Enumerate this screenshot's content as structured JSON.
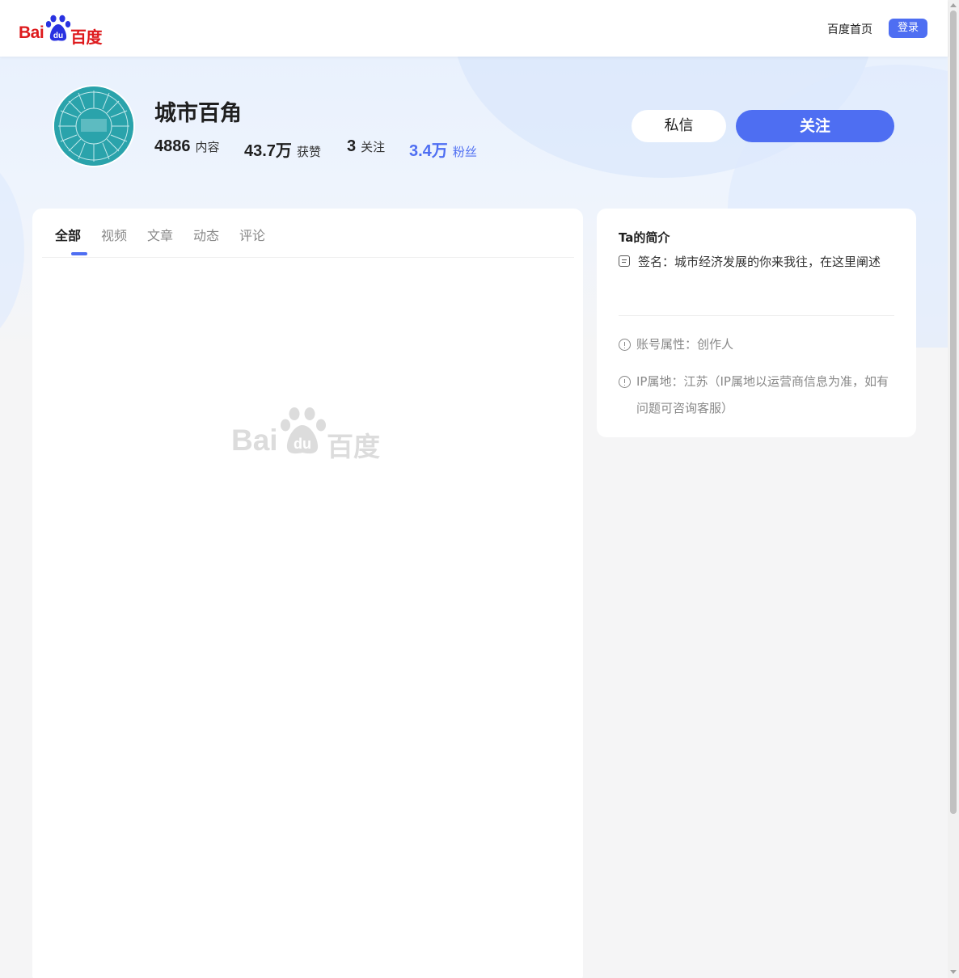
{
  "header": {
    "logo_text_latin": "Bai",
    "logo_text_du": "du",
    "logo_text_cn": "百度",
    "home_link": "百度首页",
    "login_label": "登录"
  },
  "profile": {
    "name": "城市百角",
    "stats": [
      {
        "value": "4886",
        "label": "内容"
      },
      {
        "value": "43.7万",
        "label": "获赞"
      },
      {
        "value": "3",
        "label": "关注"
      },
      {
        "value": "3.4万",
        "label": "粉丝"
      }
    ],
    "message_label": "私信",
    "follow_label": "关注"
  },
  "tabs": [
    {
      "label": "全部",
      "active": true
    },
    {
      "label": "视频",
      "active": false
    },
    {
      "label": "文章",
      "active": false
    },
    {
      "label": "动态",
      "active": false
    },
    {
      "label": "评论",
      "active": false
    }
  ],
  "intro": {
    "title": "Ta的简介",
    "signature": "签名：城市经济发展的你来我往，在这里阐述",
    "account_type": "账号属性：创作人",
    "ip_location": "IP属地：江苏（IP属地以运营商信息为准，如有问题可咨询客服）"
  },
  "colors": {
    "brand_blue": "#4e6ef2",
    "logo_red": "#de1a1d",
    "logo_blue": "#2932e1"
  }
}
